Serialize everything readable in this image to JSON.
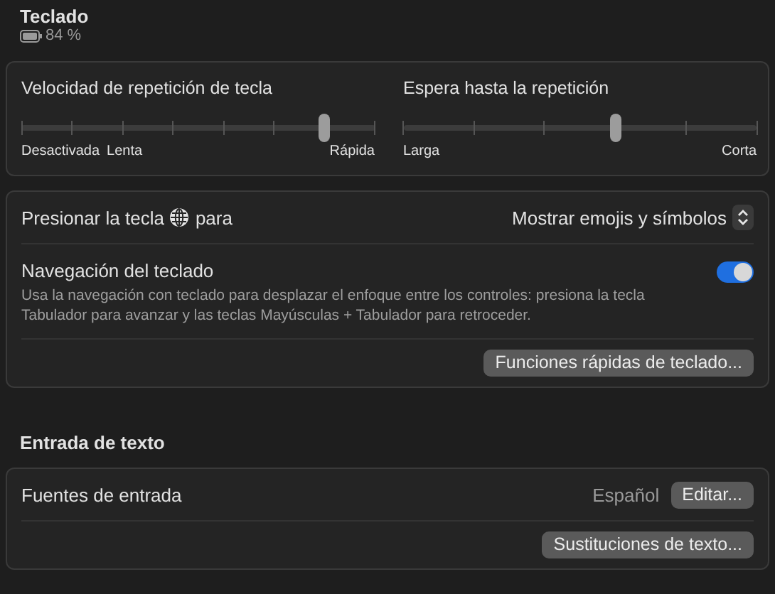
{
  "header": {
    "title": "Teclado",
    "battery": "84 %"
  },
  "sliders": [
    {
      "kind": "speed",
      "label": "Velocidad de repetición de tecla",
      "level": 0.857,
      "start_labels": [
        "Desactivada",
        "Lenta"
      ],
      "end_labels": [
        "Rápida"
      ]
    },
    {
      "kind": "delay",
      "label": "Espera hasta la repetición",
      "level": 0.6,
      "start_labels": [
        "Larga"
      ],
      "end_labels": [
        "Corta"
      ]
    }
  ],
  "globe_key": {
    "label_before": "Presionar la tecla",
    "label_after": "para",
    "value": "Mostrar emojis y símbolos"
  },
  "keyboard_navigation": {
    "label": "Navegación del teclado",
    "description": "Usa la navegación con teclado para desplazar el enfoque entre los controles: presiona la tecla Tabulador para avanzar y las teclas Mayúsculas + Tabulador para retroceder.",
    "on": true
  },
  "shortcuts_button": "Funciones rápidas de teclado...",
  "text_input": {
    "section_title": "Entrada de texto",
    "input_sources_label": "Fuentes de entrada",
    "input_sources_value": "Español",
    "edit_button": "Editar...",
    "replacements_button": "Sustituciones de texto..."
  }
}
